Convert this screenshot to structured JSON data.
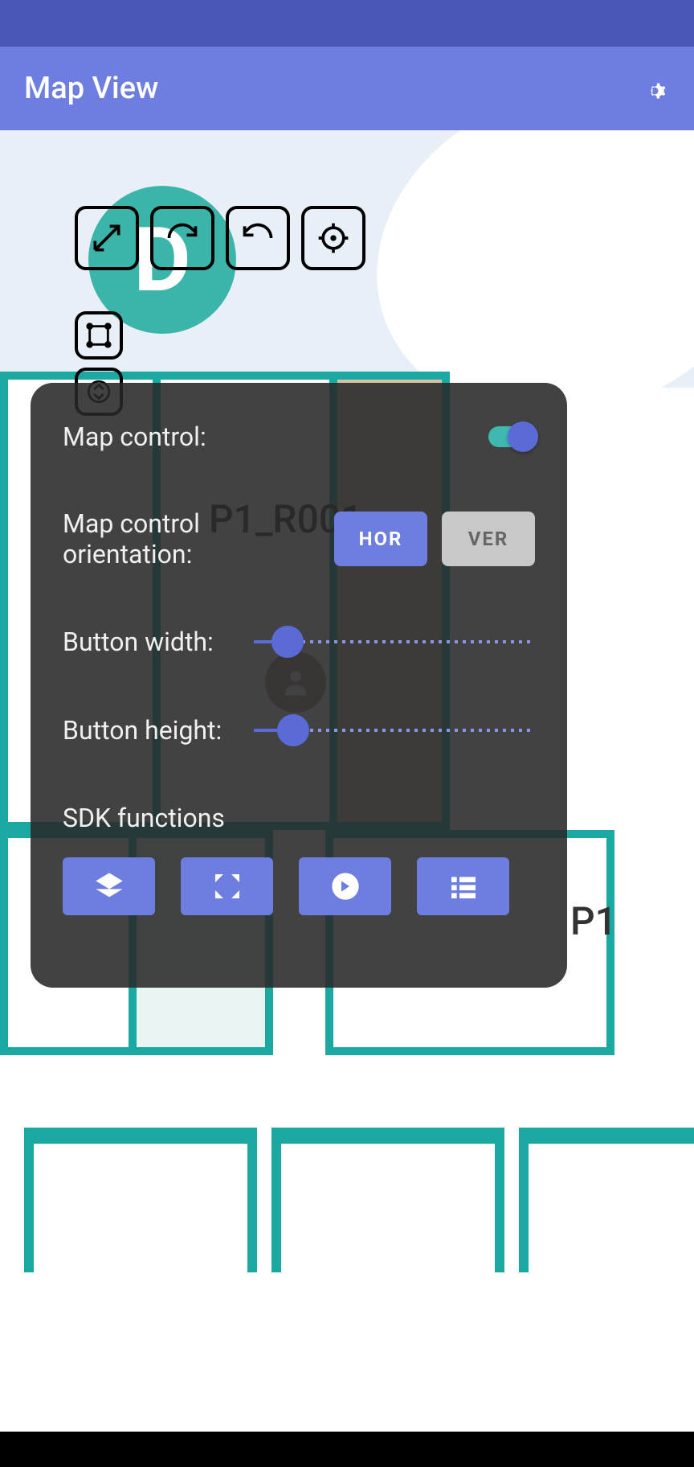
{
  "header": {
    "title": "Map View"
  },
  "map": {
    "room_label_1": "P1_R001",
    "room_label_2": "P1"
  },
  "panel": {
    "map_control_label": "Map control:",
    "map_control_on": true,
    "orientation_label": "Map control orientation:",
    "hor_label": "HOR",
    "ver_label": "VER",
    "orientation_selected": "HOR",
    "button_width_label": "Button width:",
    "button_width_value": 12,
    "button_height_label": "Button height:",
    "button_height_value": 14,
    "sdk_label": "SDK functions"
  },
  "icons": {
    "expand": "expand-icon",
    "rotate_cw": "rotate-cw-icon",
    "rotate_ccw": "rotate-ccw-icon",
    "center": "center-icon",
    "shape": "shape-icon",
    "elevator": "elevator-icon",
    "layers": "layers-icon",
    "fullscreen": "fullscreen-icon",
    "forward": "forward-icon",
    "list": "list-icon"
  },
  "colors": {
    "primary": "#6d7de0",
    "primary_dark": "#4a57b5",
    "teal": "#1ba8a0",
    "panel_bg": "rgba(40,40,40,.88)"
  }
}
